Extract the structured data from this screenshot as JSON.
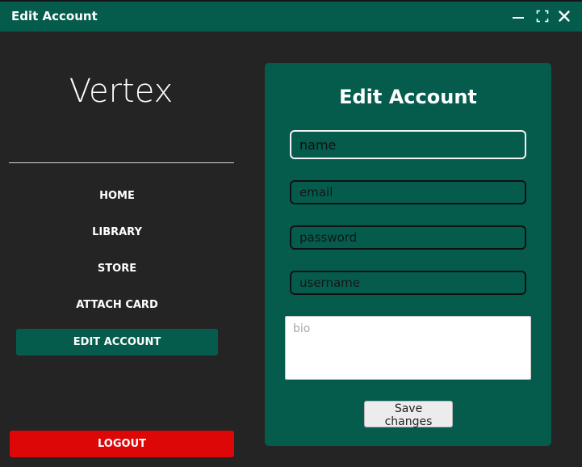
{
  "window": {
    "title": "Edit Account",
    "controls": [
      "minimize-icon",
      "maximize-icon",
      "close-icon"
    ]
  },
  "sidebar": {
    "brand": "Vertex",
    "items": [
      {
        "label": "HOME",
        "active": false
      },
      {
        "label": "LIBRARY",
        "active": false
      },
      {
        "label": "STORE",
        "active": false
      },
      {
        "label": "ATTACH CARD",
        "active": false
      },
      {
        "label": "EDIT ACCOUNT",
        "active": true
      }
    ],
    "logout_label": "LOGOUT"
  },
  "form": {
    "title": "Edit Account",
    "name_placeholder": "name",
    "email_placeholder": "email",
    "password_placeholder": "password",
    "username_placeholder": "username",
    "bio_placeholder": "bio",
    "save_label": "Save changes"
  },
  "colors": {
    "brand_green": "#055c4d",
    "background": "#242424",
    "logout_red": "#dd0707",
    "text_white": "#ffffff"
  }
}
